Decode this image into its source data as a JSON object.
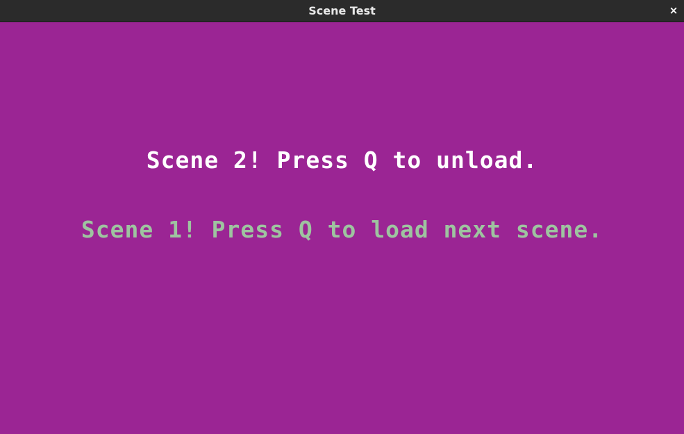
{
  "window": {
    "title": "Scene Test",
    "close_glyph": "×"
  },
  "colors": {
    "background": "#9b2594",
    "titlebar": "#2b2b2b",
    "scene2_text": "#ffffff",
    "scene1_text": "#9ec4a0"
  },
  "scenes": {
    "scene2_text": "Scene 2! Press Q to unload.",
    "scene1_text": "Scene 1! Press Q to load next scene."
  }
}
